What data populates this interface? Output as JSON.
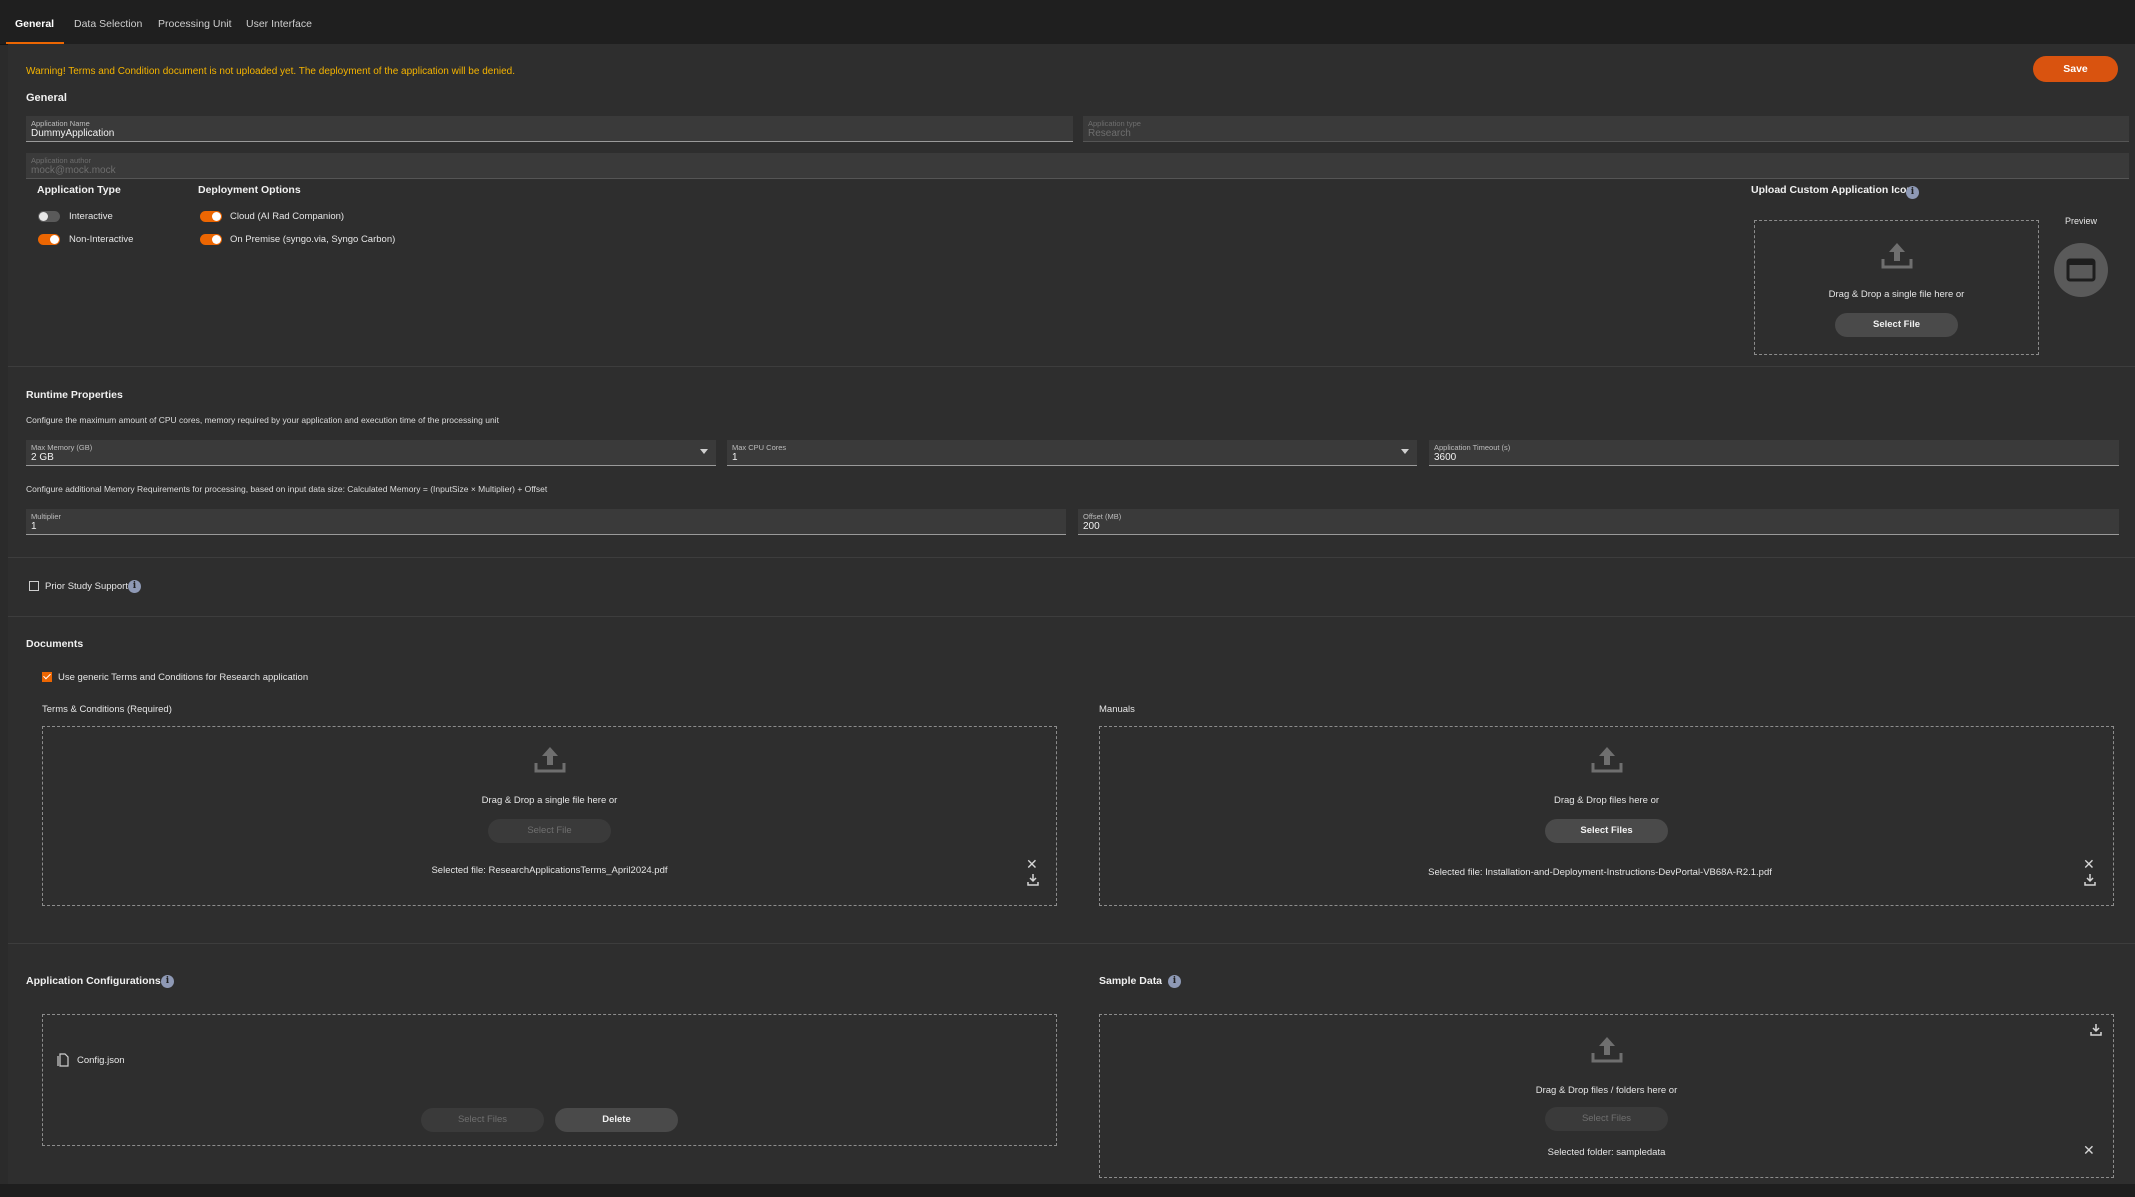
{
  "tabs": [
    {
      "label": "General"
    },
    {
      "label": "Data Selection"
    },
    {
      "label": "Processing Unit"
    },
    {
      "label": "User Interface"
    }
  ],
  "warning": "Warning! Terms and Condition document is not uploaded yet. The deployment of the application will be denied.",
  "save_label": "Save",
  "general": {
    "title": "General",
    "app_name": {
      "label": "Application Name",
      "value": "DummyApplication"
    },
    "app_type_field": {
      "label": "Application type",
      "value": "Research"
    },
    "app_author": {
      "label": "Application author",
      "value": "mock@mock.mock"
    },
    "app_type": {
      "title": "Application Type",
      "options": [
        {
          "label": "Interactive",
          "on": false
        },
        {
          "label": "Non-Interactive",
          "on": true
        }
      ]
    },
    "deployment": {
      "title": "Deployment Options",
      "options": [
        {
          "label": "Cloud (AI Rad Companion)",
          "on": true
        },
        {
          "label": "On Premise (syngo.via, Syngo Carbon)",
          "on": true
        }
      ]
    },
    "icon_upload": {
      "title": "Upload Custom Application Icon",
      "drop_text": "Drag & Drop a single file here or",
      "button": "Select File",
      "preview_label": "Preview"
    }
  },
  "runtime": {
    "title": "Runtime Properties",
    "desc1": "Configure the maximum amount of CPU cores, memory required by your application and execution time of the processing unit",
    "max_memory": {
      "label": "Max Memory (GB)",
      "value": "2 GB"
    },
    "max_cpu": {
      "label": "Max CPU Cores",
      "value": "1"
    },
    "timeout": {
      "label": "Application Timeout (s)",
      "value": "3600"
    },
    "desc2": "Configure additional Memory Requirements for processing, based on input data size: Calculated Memory = (InputSize × Multiplier) + Offset",
    "multiplier": {
      "label": "Multiplier",
      "value": "1"
    },
    "offset": {
      "label": "Offset (MB)",
      "value": "200"
    }
  },
  "prior_study": {
    "label": "Prior Study Support",
    "checked": false
  },
  "documents": {
    "title": "Documents",
    "generic_terms": {
      "label": "Use generic Terms and Conditions for Research application",
      "checked": true
    },
    "terms": {
      "label": "Terms & Conditions (Required)",
      "drop_text": "Drag & Drop a single file here or",
      "button": "Select File",
      "selected": "Selected file: ResearchApplicationsTerms_April2024.pdf"
    },
    "manuals": {
      "label": "Manuals",
      "drop_text": "Drag & Drop files here or",
      "button": "Select Files",
      "selected": "Selected file: Installation-and-Deployment-Instructions-DevPortal-VB68A-R2.1.pdf"
    }
  },
  "app_config": {
    "title": "Application Configurations",
    "file": "Config.json",
    "select_button": "Select Files",
    "delete_button": "Delete"
  },
  "sample_data": {
    "title": "Sample Data",
    "drop_text": "Drag & Drop files / folders here or",
    "button": "Select Files",
    "selected": "Selected folder: sampledata"
  },
  "colors": {
    "accent": "#ec6602",
    "warning": "#f5b400",
    "save": "#d9530f"
  }
}
